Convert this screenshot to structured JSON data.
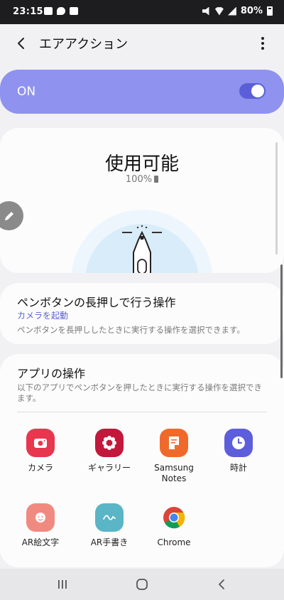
{
  "status_bar": {
    "time": "23:15",
    "battery_text": "80%",
    "icons": [
      "image-icon",
      "message-icon",
      "youtube-icon",
      "mute-icon",
      "wifi-icon",
      "signal-icon",
      "battery-icon"
    ]
  },
  "app_bar": {
    "title": "エアアクション",
    "back_icon": "back-chevron-icon",
    "more_icon": "more-vert-icon"
  },
  "toggle": {
    "label": "ON",
    "state": true
  },
  "status_card": {
    "title": "使用可能",
    "battery": "100%"
  },
  "pen_button_card": {
    "title": "ペンボタンの長押しで行う操作",
    "current_action": "カメラを起動",
    "description": "ペンボタンを長押ししたときに実行する操作を選択できます。"
  },
  "app_actions_card": {
    "title": "アプリの操作",
    "description": "以下のアプリでペンボタンを押したときに実行する操作を選択できます。",
    "apps": [
      {
        "label": "カメラ",
        "icon": "camera-icon"
      },
      {
        "label": "ギャラリー",
        "icon": "gallery-icon"
      },
      {
        "label": "Samsung Notes",
        "icon": "samsung-notes-icon"
      },
      {
        "label": "時計",
        "icon": "clock-icon"
      },
      {
        "label": "AR絵文字",
        "icon": "ar-emoji-icon"
      },
      {
        "label": "AR手書き",
        "icon": "ar-doodle-icon"
      },
      {
        "label": "Chrome",
        "icon": "chrome-icon"
      }
    ]
  },
  "colors": {
    "accent": "#8f92ee",
    "link": "#5d62d3",
    "background": "#f1f1f3"
  }
}
